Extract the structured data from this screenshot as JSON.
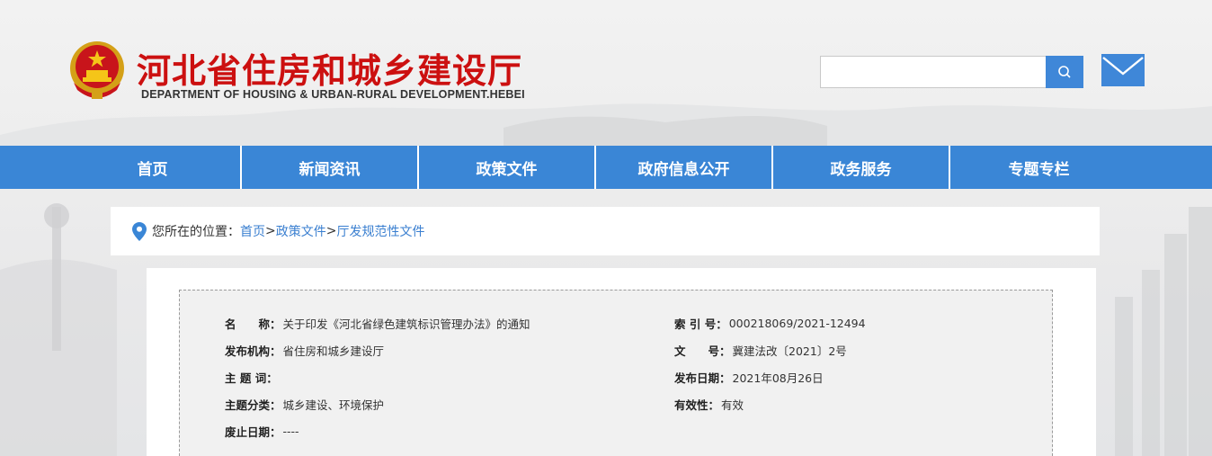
{
  "header": {
    "title_cn": "河北省住房和城乡建设厅",
    "title_en": "DEPARTMENT OF HOUSING & URBAN-RURAL DEVELOPMENT.HEBEI",
    "emblem_icon": "national-emblem-icon",
    "search": {
      "value": "",
      "placeholder": "",
      "button_icon": "search-icon"
    },
    "mail_icon": "mail-icon"
  },
  "nav": {
    "items": [
      {
        "label": "首页"
      },
      {
        "label": "新闻资讯"
      },
      {
        "label": "政策文件"
      },
      {
        "label": "政府信息公开"
      },
      {
        "label": "政务服务"
      },
      {
        "label": "专题专栏"
      }
    ]
  },
  "breadcrumb": {
    "icon": "location-pin-icon",
    "prefix": "您所在的位置：",
    "items": [
      {
        "label": "首页"
      },
      {
        "label": "政策文件"
      },
      {
        "label": "厅发规范性文件"
      }
    ],
    "separator": ">"
  },
  "meta": {
    "name_label": "名　　称：",
    "name_value": "关于印发《河北省绿色建筑标识管理办法》的通知",
    "index_label": "索 引 号：",
    "index_value": "000218069/2021-12494",
    "org_label": "发布机构：",
    "org_value": "省住房和城乡建设厅",
    "docno_label": "文　　号：",
    "docno_value": "冀建法改〔2021〕2号",
    "keywords_label": "主 题 词：",
    "keywords_value": "",
    "date_label": "发布日期：",
    "date_value": "2021年08月26日",
    "category_label": "主题分类：",
    "category_value": "城乡建设、环境保护",
    "validity_label": "有效性：",
    "validity_value": "有效",
    "expiry_label": "废止日期：",
    "expiry_value": "----"
  },
  "colors": {
    "brand_red": "#cc1010",
    "nav_blue": "#3a86d6",
    "link_blue": "#3a7fd0",
    "pin_blue": "#3a86d6"
  }
}
